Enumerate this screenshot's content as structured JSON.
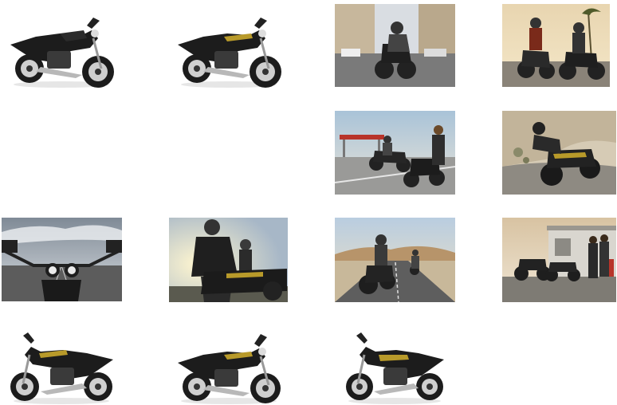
{
  "gallery": {
    "items": [
      {
        "kind": "studio-bike",
        "variant": "black",
        "facing": "right"
      },
      {
        "kind": "studio-bike",
        "variant": "black-gold",
        "facing": "right"
      },
      {
        "kind": "photo",
        "scene": "city-street-rider"
      },
      {
        "kind": "photo",
        "scene": "two-riders-palm-boulevard"
      },
      {
        "kind": "photo",
        "scene": "gas-station-couple"
      },
      {
        "kind": "photo",
        "scene": "dusty-corner-rider"
      },
      {
        "kind": "photo",
        "scene": "rider-pov-handlebar"
      },
      {
        "kind": "photo",
        "scene": "sunset-rider-portrait"
      },
      {
        "kind": "photo",
        "scene": "desert-road-riders"
      },
      {
        "kind": "photo",
        "scene": "bikes-parked-at-shed"
      },
      {
        "kind": "studio-bike",
        "variant": "black-gold",
        "facing": "left"
      },
      {
        "kind": "studio-bike",
        "variant": "black-gold",
        "facing": "right"
      },
      {
        "kind": "studio-bike",
        "variant": "black-gold",
        "facing": "left"
      }
    ]
  },
  "colors": {
    "background": "#ffffff",
    "bike_body": "#1c1c1c",
    "gold_stripe": "#b89a2a",
    "chrome": "#b8b8b8",
    "sky": "#c9d9ea",
    "road": "#6b6b6b",
    "sand": "#c8b89a"
  }
}
